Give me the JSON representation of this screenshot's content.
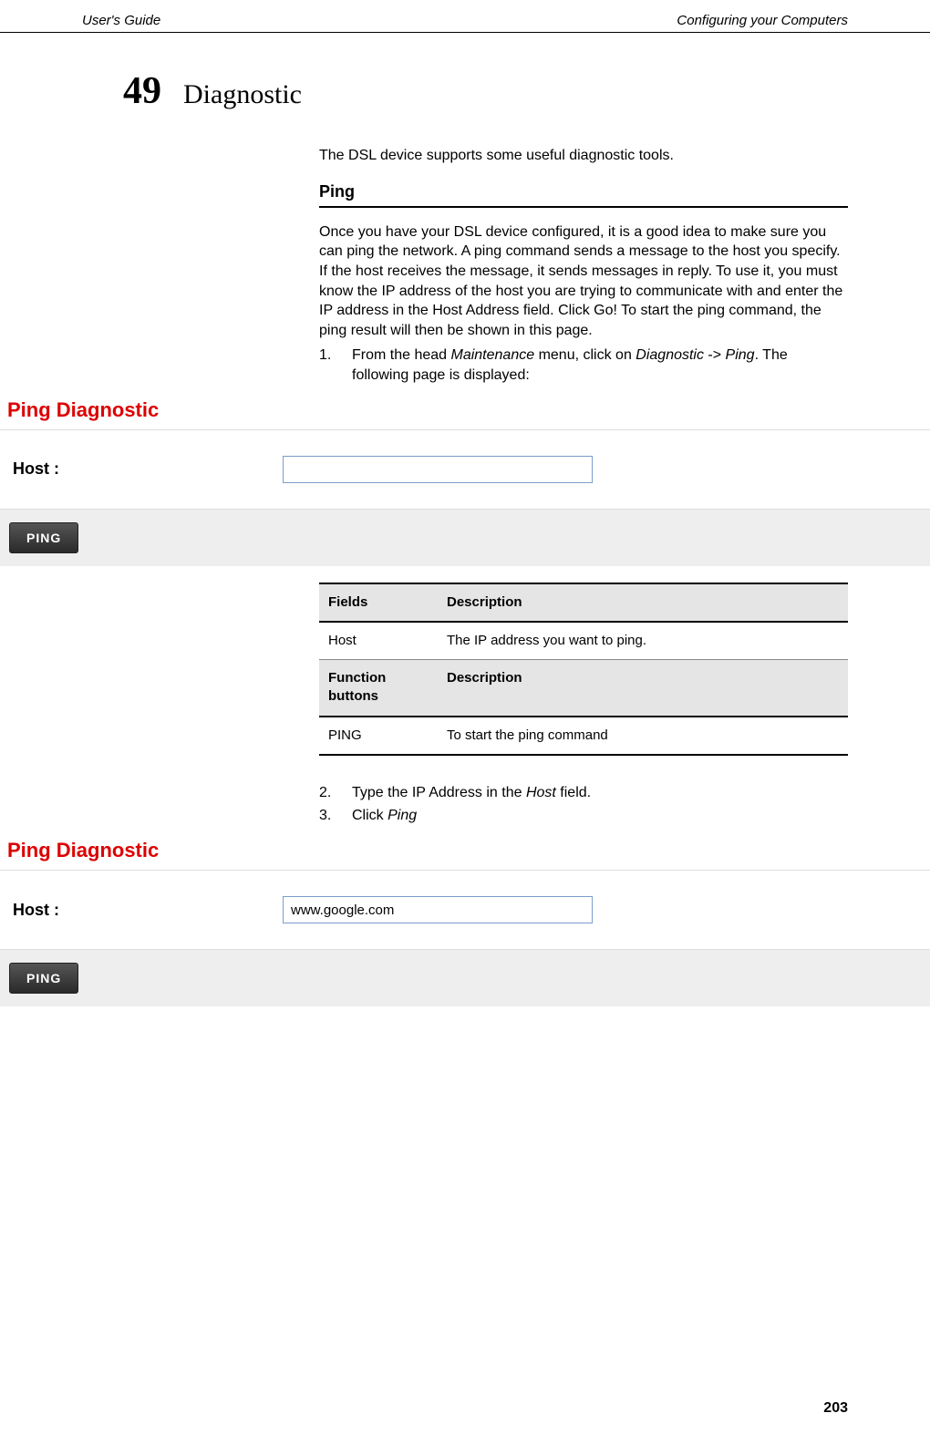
{
  "header": {
    "left": "User's Guide",
    "right": "Configuring your Computers"
  },
  "chapter": {
    "number": "49",
    "title": "Diagnostic"
  },
  "intro": "The DSL device supports some useful diagnostic tools.",
  "section": {
    "heading": "Ping",
    "body": "Once you have your DSL device configured, it is a good idea to make sure you can ping the network. A ping command sends a message to the host you specify. If the host receives the message, it sends messages in reply. To use it, you must know the IP address of the host you are trying to communicate with and enter the IP address in the Host Address field. Click Go! To start the ping command, the ping result will then be shown in this page."
  },
  "steps1": {
    "num": "1.",
    "pre": "From the head ",
    "m1": "Maintenance",
    "mid": " menu, click on ",
    "m2": "Diagnostic",
    "arrow": "  -> ",
    "m3": "Ping",
    "post": ". The following page is displayed:"
  },
  "panel1": {
    "title": "Ping Diagnostic",
    "host_label": "Host :",
    "host_value": "",
    "button": "PING"
  },
  "table": {
    "h1a": "Fields",
    "h1b": "Description",
    "r1a": "Host",
    "r1b": "The IP address you want to ping.",
    "h2a": "Function buttons",
    "h2b": "Description",
    "r2a": "PING",
    "r2b": "To start the ping command"
  },
  "steps2": [
    {
      "num": "2.",
      "pre": "Type the IP Address in the ",
      "em": "Host",
      "post": " field."
    },
    {
      "num": "3.",
      "pre": "Click ",
      "em": "Ping",
      "post": ""
    }
  ],
  "panel2": {
    "title": "Ping Diagnostic",
    "host_label": "Host :",
    "host_value": "www.google.com",
    "button": "PING"
  },
  "page_number": "203"
}
